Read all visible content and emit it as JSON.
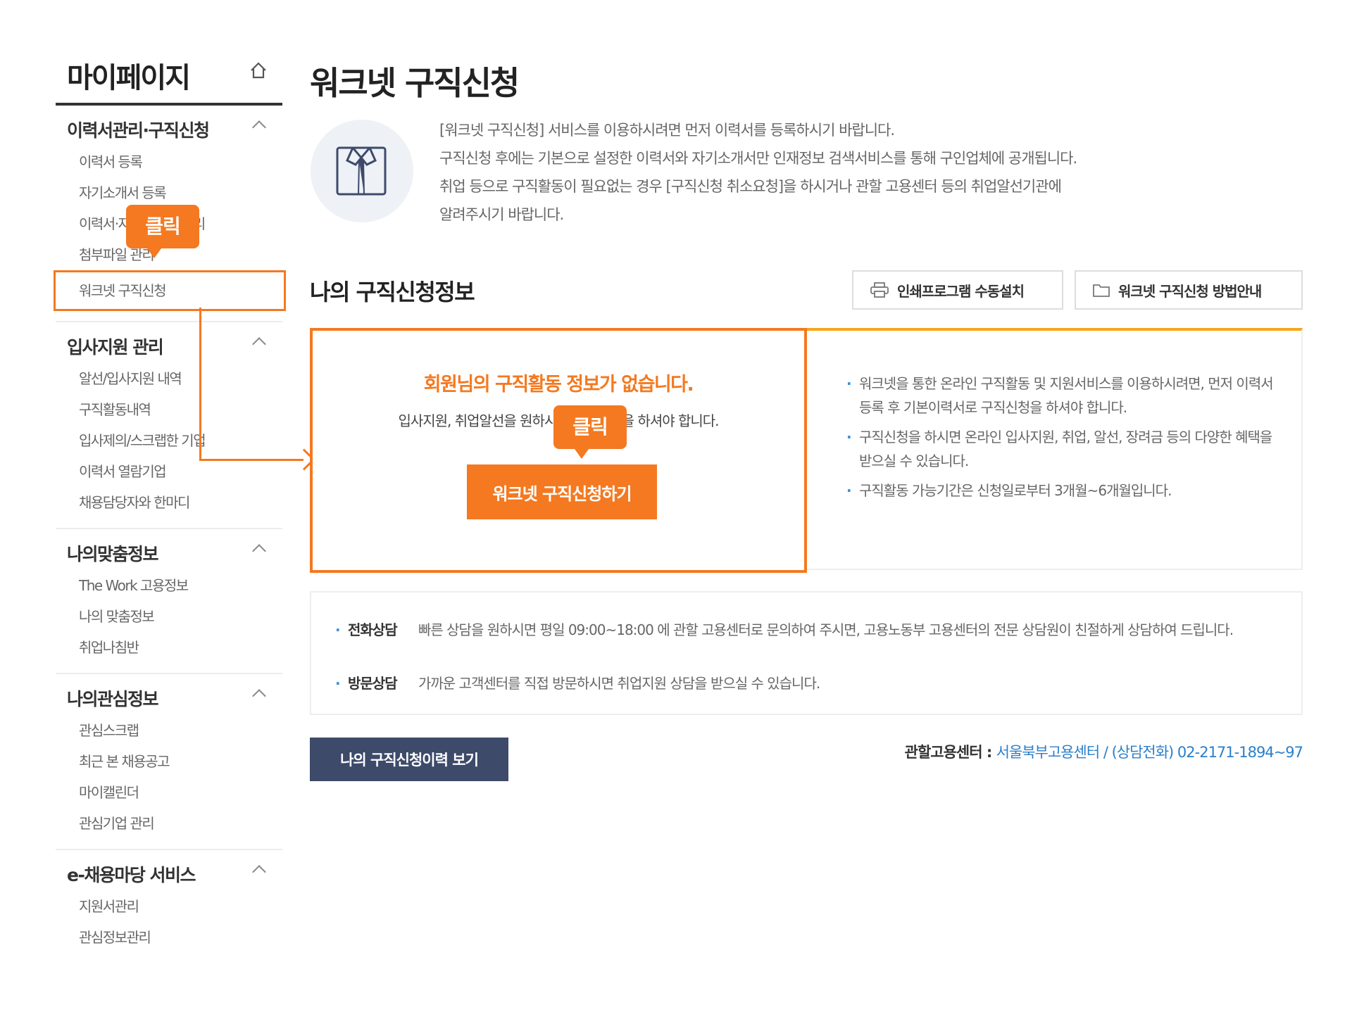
{
  "sidebar": {
    "title": "마이페이지",
    "sections": [
      {
        "title": "이력서관리·구직신청",
        "items": [
          "이력서 등록",
          "자기소개서 등록",
          "이력서·자기소개서 관리",
          "첨부파일 관리",
          "워크넷 구직신청"
        ]
      },
      {
        "title": "입사지원 관리",
        "items": [
          "알선/입사지원 내역",
          "구직활동내역",
          "입사제의/스크랩한 기업",
          "이력서 열람기업",
          "채용담당자와 한마디"
        ]
      },
      {
        "title": "나의맞춤정보",
        "items": [
          "The Work 고용정보",
          "나의 맞춤정보",
          "취업나침반"
        ]
      },
      {
        "title": "나의관심정보",
        "items": [
          "관심스크랩",
          "최근 본 채용공고",
          "마이캘린더",
          "관심기업 관리"
        ]
      },
      {
        "title": "e-채용마당 서비스",
        "items": [
          "지원서관리",
          "관심정보관리"
        ]
      }
    ]
  },
  "callouts": {
    "first": "클릭",
    "second": "클릭"
  },
  "main": {
    "title": "워크넷 구직신청",
    "intro": [
      "[워크넷 구직신청] 서비스를 이용하시려면 먼저 이력서를 등록하시기 바랍니다.",
      "구직신청 후에는 기본으로 설정한 이력서와 자기소개서만 인재정보 검색서비스를 통해 구인업체에 공개됩니다.",
      "취업 등으로 구직활동이 필요없는 경우 [구직신청 취소요청]을 하시거나 관할 고용센터 등의 취업알선기관에",
      "알려주시기 바랍니다."
    ],
    "subtitle": "나의 구직신청정보",
    "print_button": "인쇄프로그램 수동설치",
    "guide_button": "워크넷 구직신청 방법안내",
    "no_info": "회원님의 구직활동 정보가 없습니다.",
    "need_apply": "입사지원, 취업알선을 원하시면 구직신청을 하셔야 합니다.",
    "apply_button": "워크넷 구직신청하기",
    "notes": [
      "워크넷을 통한 온라인 구직활동 및 지원서비스를 이용하시려면, 먼저 이력서 등록 후 기본이력서로 구직신청을 하셔야 합니다.",
      "구직신청을 하시면 온라인 입사지원, 취업, 알선, 장려금 등의 다양한 혜택을 받으실 수 있습니다.",
      "구직활동 가능기간은 신청일로부터 3개월~6개월입니다."
    ],
    "consult": [
      {
        "label": "전화상담",
        "text": "빠른 상담을 원하시면 평일 09:00~18:00 에 관할 고용센터로 문의하여 주시면, 고용노동부 고용센터의 전문 상담원이 친절하게 상담하여 드립니다."
      },
      {
        "label": "방문상담",
        "text": "가까운 고객센터를 직접 방문하시면 취업지원 상담을 받으실 수 있습니다."
      }
    ],
    "history_button": "나의 구직신청이력 보기",
    "center_label": "관할고용센터 : ",
    "center_value": "서울북부고용센터 / (상담전화) 02-2171-1894~97"
  },
  "colors": {
    "accent": "#f47920",
    "navy": "#3d4a6a",
    "link": "#2b7fc9",
    "bar": "#f7a51c"
  }
}
